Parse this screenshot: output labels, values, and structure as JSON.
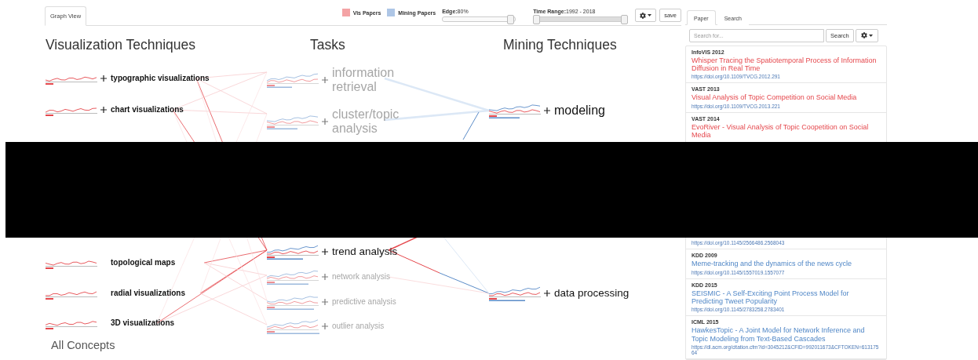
{
  "main_tabs": [
    {
      "label": "Graph View",
      "selected": true
    }
  ],
  "legend": [
    {
      "label": "Vis Papers",
      "color": "#f4a3a5"
    },
    {
      "label": "Mining Papers",
      "color": "#aec6e6"
    }
  ],
  "edge_slider": {
    "label": "Edge:",
    "value": "80%",
    "level": 0.93
  },
  "time_range": {
    "label": "Time Range:",
    "value": "1992 - 2018",
    "level": 1
  },
  "save_button": "save",
  "columns": [
    {
      "title": "Visualization Techniques",
      "kind": "vis",
      "nodes": [
        {
          "label": "typographic visualizations",
          "expandable": true,
          "active": true,
          "kind": "small"
        },
        {
          "label": "chart visualizations",
          "expandable": true,
          "active": true,
          "kind": "small"
        },
        {
          "label": "topological maps",
          "expandable": false,
          "active": true,
          "kind": "small"
        },
        {
          "label": "radial visualizations",
          "expandable": false,
          "active": true,
          "kind": "small"
        },
        {
          "label": "3D visualizations",
          "expandable": false,
          "active": true,
          "kind": "small"
        }
      ]
    },
    {
      "title": "Tasks",
      "kind": "task",
      "nodes": [
        {
          "label": "information retrieval",
          "expandable": true,
          "active": false,
          "kind": "large"
        },
        {
          "label": "cluster/topic analysis",
          "expandable": true,
          "active": false,
          "kind": "large"
        },
        {
          "label": "trend analysis",
          "expandable": true,
          "active": true,
          "kind": "medium"
        },
        {
          "label": "network analysis",
          "expandable": true,
          "active": false,
          "kind": "small"
        },
        {
          "label": "predictive analysis",
          "expandable": true,
          "active": false,
          "kind": "small"
        },
        {
          "label": "outlier analysis",
          "expandable": true,
          "active": false,
          "kind": "small"
        }
      ]
    },
    {
      "title": "Mining Techniques",
      "kind": "mining",
      "nodes": [
        {
          "label": "modeling",
          "expandable": true,
          "active": true,
          "kind": "large"
        },
        {
          "label": "data processing",
          "expandable": true,
          "active": true,
          "kind": "medium"
        }
      ]
    }
  ],
  "all_concepts": "All Concepts",
  "side_tabs": [
    {
      "label": "Paper",
      "selected": true
    },
    {
      "label": "Search",
      "selected": false
    }
  ],
  "search": {
    "placeholder": "Search for...",
    "button": "Search"
  },
  "papers": [
    {
      "kind": "vis",
      "venue": "InfoVIS 2012",
      "title": "Whisper Tracing the Spatiotemporal Process of Information Diffusion in Real Time",
      "url": "https://doi.org/10.1109/TVCG.2012.291"
    },
    {
      "kind": "vis",
      "venue": "VAST 2013",
      "title": "Visual Analysis of Topic Competition on Social Media",
      "url": "https://doi.org/10.1109/TVCG.2013.221"
    },
    {
      "kind": "vis",
      "venue": "VAST 2014",
      "title": "EvoRiver - Visual Analysis of Topic Coopetition on Social Media"
    },
    {
      "url": "https://doi.org/10.1145/2566486.2568043"
    },
    {
      "kind": "mining",
      "venue": "KDD 2009",
      "title": "Meme-tracking and the dynamics of the news cycle",
      "url": "https://doi.org/10.1145/1557019.1557077"
    },
    {
      "kind": "mining",
      "venue": "KDD 2015",
      "title": "SEISMIC - A Self-Exciting Point Process Model for Predicting Tweet Popularity",
      "url": "https://doi.org/10.1145/2783258.2783401"
    },
    {
      "kind": "mining",
      "venue": "ICML 2015",
      "title": "HawkesTopic - A Joint Model for Network Inference and Topic Modeling from Text-Based Cascades",
      "url": "https://dl.acm.org/citation.cfm?id=3045212&CFID=992011673&CFTOKEN=61317564"
    }
  ]
}
